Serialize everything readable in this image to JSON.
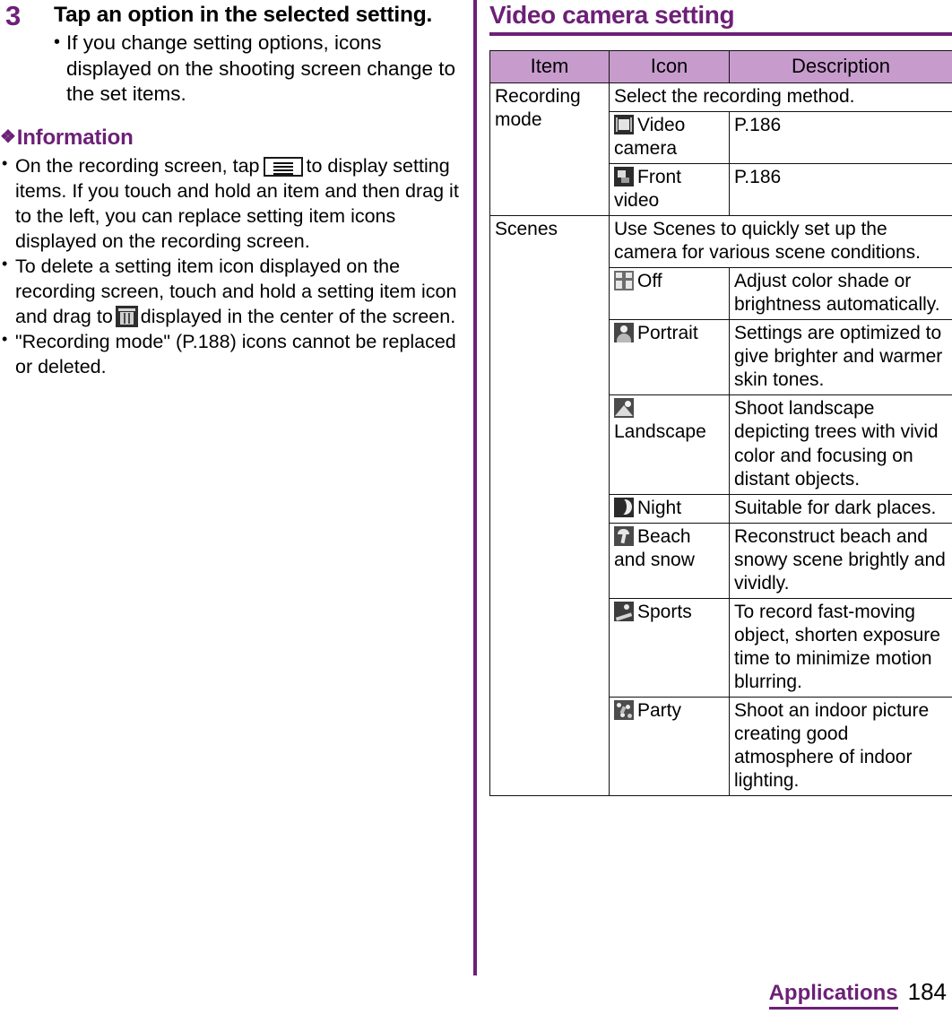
{
  "page": {
    "number": "184",
    "chapter": "Applications"
  },
  "left_column": {
    "step": {
      "number": "3",
      "title": "Tap an option in the selected setting.",
      "sub_bullets": [
        "If you change setting options, icons displayed on the shooting screen change to the set items."
      ]
    },
    "information": {
      "heading": "Information",
      "diamond": "❖",
      "bullets": [
        {
          "parts": [
            {
              "type": "text",
              "value": "On the recording screen, tap "
            },
            {
              "type": "icon",
              "value": "menu-button-icon"
            },
            {
              "type": "text",
              "value": " to display setting items. If you touch and hold an item and then drag it to the left, you can replace setting item icons displayed on the recording screen."
            }
          ],
          "text_before": "On the recording screen, tap",
          "text_after": "to display setting items. If you touch and hold an item and then drag it to the left, you can replace setting item icons displayed on the recording screen."
        },
        {
          "text_before": "To delete a setting item icon displayed on the recording screen, touch and hold a setting item icon and drag to",
          "text_after": "displayed in the center of the screen."
        },
        {
          "text": "\"Recording mode\" (P.188) icons cannot be replaced or deleted."
        }
      ]
    }
  },
  "right_column": {
    "section_title": "Video camera setting",
    "table": {
      "headers": [
        "Item",
        "Icon",
        "Description"
      ],
      "groups": [
        {
          "item": "Recording mode",
          "intro": "Select the recording method.",
          "rows": [
            {
              "icon": "video-camera-icon",
              "icon_class": "ic-videocam",
              "label": "Video camera",
              "description": "P.186"
            },
            {
              "icon": "front-video-icon",
              "icon_class": "ic-frontvideo",
              "label": "Front video",
              "description": "P.186"
            }
          ]
        },
        {
          "item": "Scenes",
          "intro": "Use Scenes to quickly set up the camera for various scene conditions.",
          "rows": [
            {
              "icon": "scene-off-icon",
              "icon_class": "ic-off",
              "label": "Off",
              "description": "Adjust color shade or brightness automatically."
            },
            {
              "icon": "scene-portrait-icon",
              "icon_class": "ic-portrait",
              "label": "Portrait",
              "description": "Settings are optimized to give brighter and warmer skin tones."
            },
            {
              "icon": "scene-landscape-icon",
              "icon_class": "ic-landscape",
              "label": "Landscape",
              "description": "Shoot landscape depicting trees with vivid color and focusing on distant objects."
            },
            {
              "icon": "scene-night-icon",
              "icon_class": "ic-night",
              "label": "Night",
              "description": "Suitable for dark places."
            },
            {
              "icon": "scene-beach-snow-icon",
              "icon_class": "ic-beach",
              "label": "Beach and snow",
              "description": "Reconstruct beach and snowy scene brightly and vividly."
            },
            {
              "icon": "scene-sports-icon",
              "icon_class": "ic-sports",
              "label": "Sports",
              "description": "To record fast-moving object, shorten exposure time to minimize motion blurring."
            },
            {
              "icon": "scene-party-icon",
              "icon_class": "ic-party",
              "label": "Party",
              "description": "Shoot an indoor picture creating good atmosphere of indoor lighting."
            }
          ]
        }
      ]
    }
  },
  "colors": {
    "accent": "#6d2077",
    "table_header_bg": "#c79ccd",
    "text": "#000000"
  }
}
